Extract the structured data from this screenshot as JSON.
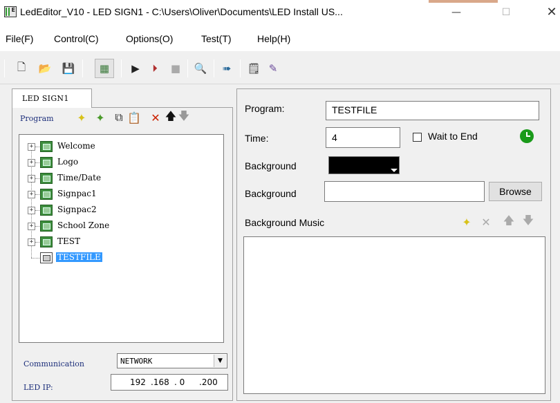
{
  "window": {
    "title": "LedEditor_V10 - LED SIGN1 - C:\\Users\\Oliver\\Documents\\LED Install US...",
    "app_icon_glyph": "E",
    "minimize_glyph": "—",
    "maximize_glyph": "☐",
    "close_glyph": "✕"
  },
  "menu": {
    "items": [
      "File(F)",
      "Control(C)",
      "Options(O)",
      "Test(T)",
      "Help(H)"
    ]
  },
  "toolbar": {
    "buttons": [
      {
        "icon": "new-file-icon",
        "glyph": "🗋"
      },
      {
        "icon": "open-folder-icon",
        "glyph": "📂"
      },
      {
        "icon": "save-icon",
        "glyph": "💾"
      },
      {
        "icon": "display-icon",
        "glyph": "▦"
      },
      {
        "icon": "play-icon",
        "glyph": "▶"
      },
      {
        "icon": "play-step-icon",
        "glyph": "⏵"
      },
      {
        "icon": "stop-icon",
        "glyph": "■"
      },
      {
        "icon": "zoom-icon",
        "glyph": "🔍"
      },
      {
        "icon": "send-icon",
        "glyph": "➠"
      },
      {
        "icon": "properties-icon",
        "glyph": "🗒"
      },
      {
        "icon": "clean-brush-icon",
        "glyph": "✎"
      }
    ]
  },
  "left_pane": {
    "tab_label": "LED SIGN1",
    "program_label": "Program",
    "tree_tools": [
      {
        "icon": "new-program-icon",
        "glyph": "✦",
        "color": "#d8c21a"
      },
      {
        "icon": "new-item-icon",
        "glyph": "✦",
        "color": "#4a9a2a"
      },
      {
        "icon": "copy-icon",
        "glyph": "⧉",
        "color": "#333333"
      },
      {
        "icon": "paste-icon",
        "glyph": "📋",
        "color": "#777777"
      },
      {
        "icon": "delete-icon",
        "glyph": "✕",
        "color": "#cc2200"
      },
      {
        "icon": "move-up-icon",
        "glyph": "🡅",
        "color": "#111111"
      },
      {
        "icon": "move-down-icon",
        "glyph": "🡇",
        "color": "#999999"
      }
    ],
    "programs": [
      {
        "label": "Welcome",
        "expandable": true,
        "selected": false
      },
      {
        "label": "Logo",
        "expandable": true,
        "selected": false
      },
      {
        "label": "Time/Date",
        "expandable": true,
        "selected": false
      },
      {
        "label": "Signpac1",
        "expandable": true,
        "selected": false
      },
      {
        "label": "Signpac2",
        "expandable": true,
        "selected": false
      },
      {
        "label": "School Zone",
        "expandable": true,
        "selected": false
      },
      {
        "label": "TEST",
        "expandable": true,
        "selected": false
      },
      {
        "label": "TESTFILE",
        "expandable": false,
        "selected": true
      }
    ],
    "communication_label": "Communication",
    "communication_value": "NETWORK",
    "ip_label": "LED IP:",
    "ip_octets": [
      "192",
      ".168",
      ".  0",
      ".200"
    ]
  },
  "right_pane": {
    "program_label": "Program:",
    "program_value": "TESTFILE",
    "time_label": "Time:",
    "time_value": "4",
    "wait_to_end_label": "Wait to End",
    "wait_to_end_checked": false,
    "background_color_label": "Background",
    "background_color": "#000000",
    "background_image_label": "Background",
    "background_image_value": "",
    "browse_label": "Browse",
    "background_music_label": "Background Music",
    "music_tools": [
      {
        "icon": "add-music-icon",
        "glyph": "✦",
        "color": "#d8c21a"
      },
      {
        "icon": "remove-music-icon",
        "glyph": "✕",
        "color": "#aaaaaa"
      },
      {
        "icon": "music-up-icon",
        "glyph": "🡅",
        "color": "#aaaaaa"
      },
      {
        "icon": "music-down-icon",
        "glyph": "🡇",
        "color": "#aaaaaa"
      }
    ]
  }
}
